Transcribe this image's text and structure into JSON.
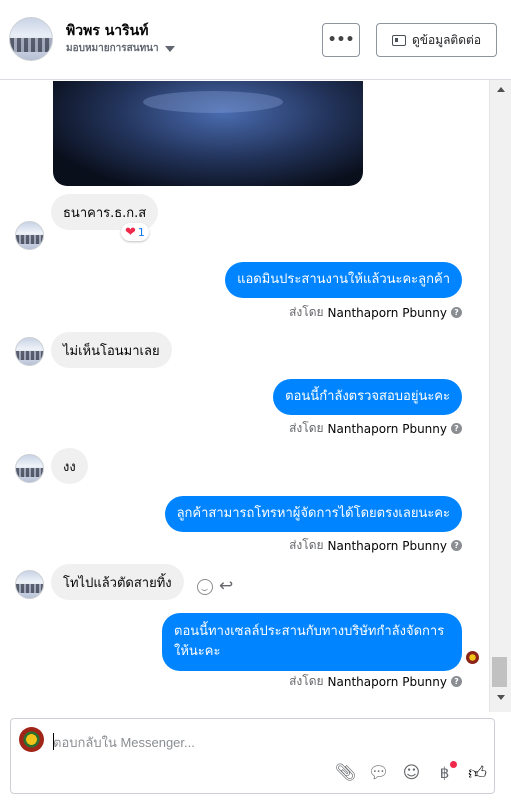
{
  "header": {
    "contact_name": "พิวพร นารินท์",
    "assignment": "มอบหมายการสนทนา",
    "more_label": "•••",
    "contact_info_label": "ดูข้อมูลติดต่อ"
  },
  "messages": [
    {
      "side": "in",
      "text": "ธนาคาร.ธ.ก.ส",
      "reaction": {
        "emoji": "❤",
        "count": "1"
      }
    },
    {
      "side": "out",
      "text": "แอดมินประสานงานให้แล้วนะคะลูกค้า",
      "sent_by_prefix": "ส่งโดย",
      "sent_by_name": "Nanthaporn Pbunny"
    },
    {
      "side": "in",
      "text": "ไม่เห็นโอนมาเลย"
    },
    {
      "side": "out",
      "text": "ตอนนี้กำลังตรวจสอบอยู่นะคะ",
      "sent_by_prefix": "ส่งโดย",
      "sent_by_name": "Nanthaporn Pbunny"
    },
    {
      "side": "in",
      "text": "งง"
    },
    {
      "side": "out",
      "text": "ลูกค้าสามารถโทรหาผู้จัดการได้โดยตรงเลยนะคะ",
      "sent_by_prefix": "ส่งโดย",
      "sent_by_name": "Nanthaporn Pbunny"
    },
    {
      "side": "in",
      "text": "โทไปแล้วตัดสายทิ้ง"
    },
    {
      "side": "out",
      "text_line1": "ตอนนี้ทางเซลล์ประสานกับทางบริษัทกำลังจัดการ",
      "text_line2": "ให้นะคะ",
      "sent_by_prefix": "ส่งโดย",
      "sent_by_name": "Nanthaporn Pbunny"
    }
  ],
  "composer": {
    "placeholder": "ตอบกลับใน Messenger..."
  },
  "icons": {
    "attach": "paperclip-icon",
    "saved_replies": "chat-bubble-icon",
    "emoji": "smile-icon",
    "payment": "baht-icon",
    "like": "thumbs-up-icon"
  },
  "colors": {
    "outgoing_bubble": "#0084ff",
    "incoming_bubble": "#f0f0f0",
    "notification_dot": "#f02849"
  }
}
